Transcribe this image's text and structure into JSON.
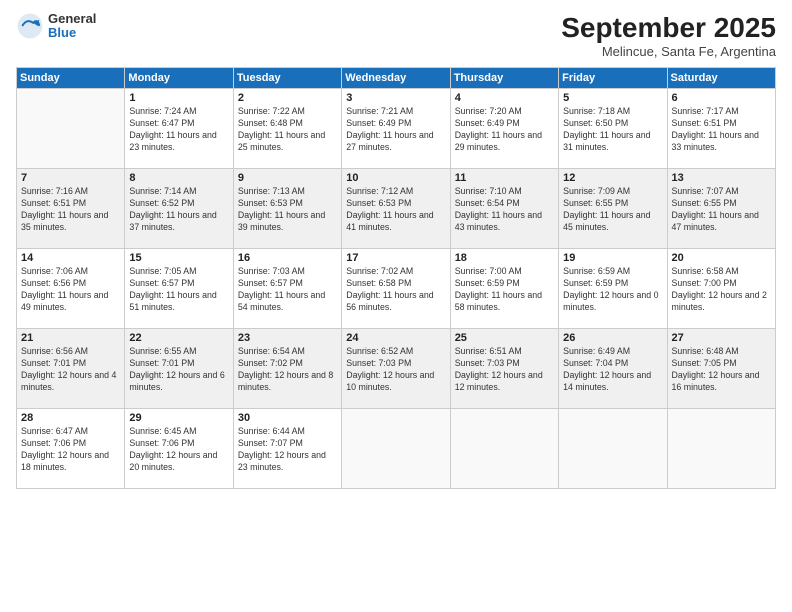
{
  "header": {
    "logo": {
      "general": "General",
      "blue": "Blue"
    },
    "title": "September 2025",
    "subtitle": "Melincue, Santa Fe, Argentina"
  },
  "days": [
    "Sunday",
    "Monday",
    "Tuesday",
    "Wednesday",
    "Thursday",
    "Friday",
    "Saturday"
  ],
  "weeks": [
    [
      {
        "day": "",
        "content": ""
      },
      {
        "day": "1",
        "sunrise": "Sunrise: 7:24 AM",
        "sunset": "Sunset: 6:47 PM",
        "daylight": "Daylight: 11 hours and 23 minutes."
      },
      {
        "day": "2",
        "sunrise": "Sunrise: 7:22 AM",
        "sunset": "Sunset: 6:48 PM",
        "daylight": "Daylight: 11 hours and 25 minutes."
      },
      {
        "day": "3",
        "sunrise": "Sunrise: 7:21 AM",
        "sunset": "Sunset: 6:49 PM",
        "daylight": "Daylight: 11 hours and 27 minutes."
      },
      {
        "day": "4",
        "sunrise": "Sunrise: 7:20 AM",
        "sunset": "Sunset: 6:49 PM",
        "daylight": "Daylight: 11 hours and 29 minutes."
      },
      {
        "day": "5",
        "sunrise": "Sunrise: 7:18 AM",
        "sunset": "Sunset: 6:50 PM",
        "daylight": "Daylight: 11 hours and 31 minutes."
      },
      {
        "day": "6",
        "sunrise": "Sunrise: 7:17 AM",
        "sunset": "Sunset: 6:51 PM",
        "daylight": "Daylight: 11 hours and 33 minutes."
      }
    ],
    [
      {
        "day": "7",
        "sunrise": "Sunrise: 7:16 AM",
        "sunset": "Sunset: 6:51 PM",
        "daylight": "Daylight: 11 hours and 35 minutes."
      },
      {
        "day": "8",
        "sunrise": "Sunrise: 7:14 AM",
        "sunset": "Sunset: 6:52 PM",
        "daylight": "Daylight: 11 hours and 37 minutes."
      },
      {
        "day": "9",
        "sunrise": "Sunrise: 7:13 AM",
        "sunset": "Sunset: 6:53 PM",
        "daylight": "Daylight: 11 hours and 39 minutes."
      },
      {
        "day": "10",
        "sunrise": "Sunrise: 7:12 AM",
        "sunset": "Sunset: 6:53 PM",
        "daylight": "Daylight: 11 hours and 41 minutes."
      },
      {
        "day": "11",
        "sunrise": "Sunrise: 7:10 AM",
        "sunset": "Sunset: 6:54 PM",
        "daylight": "Daylight: 11 hours and 43 minutes."
      },
      {
        "day": "12",
        "sunrise": "Sunrise: 7:09 AM",
        "sunset": "Sunset: 6:55 PM",
        "daylight": "Daylight: 11 hours and 45 minutes."
      },
      {
        "day": "13",
        "sunrise": "Sunrise: 7:07 AM",
        "sunset": "Sunset: 6:55 PM",
        "daylight": "Daylight: 11 hours and 47 minutes."
      }
    ],
    [
      {
        "day": "14",
        "sunrise": "Sunrise: 7:06 AM",
        "sunset": "Sunset: 6:56 PM",
        "daylight": "Daylight: 11 hours and 49 minutes."
      },
      {
        "day": "15",
        "sunrise": "Sunrise: 7:05 AM",
        "sunset": "Sunset: 6:57 PM",
        "daylight": "Daylight: 11 hours and 51 minutes."
      },
      {
        "day": "16",
        "sunrise": "Sunrise: 7:03 AM",
        "sunset": "Sunset: 6:57 PM",
        "daylight": "Daylight: 11 hours and 54 minutes."
      },
      {
        "day": "17",
        "sunrise": "Sunrise: 7:02 AM",
        "sunset": "Sunset: 6:58 PM",
        "daylight": "Daylight: 11 hours and 56 minutes."
      },
      {
        "day": "18",
        "sunrise": "Sunrise: 7:00 AM",
        "sunset": "Sunset: 6:59 PM",
        "daylight": "Daylight: 11 hours and 58 minutes."
      },
      {
        "day": "19",
        "sunrise": "Sunrise: 6:59 AM",
        "sunset": "Sunset: 6:59 PM",
        "daylight": "Daylight: 12 hours and 0 minutes."
      },
      {
        "day": "20",
        "sunrise": "Sunrise: 6:58 AM",
        "sunset": "Sunset: 7:00 PM",
        "daylight": "Daylight: 12 hours and 2 minutes."
      }
    ],
    [
      {
        "day": "21",
        "sunrise": "Sunrise: 6:56 AM",
        "sunset": "Sunset: 7:01 PM",
        "daylight": "Daylight: 12 hours and 4 minutes."
      },
      {
        "day": "22",
        "sunrise": "Sunrise: 6:55 AM",
        "sunset": "Sunset: 7:01 PM",
        "daylight": "Daylight: 12 hours and 6 minutes."
      },
      {
        "day": "23",
        "sunrise": "Sunrise: 6:54 AM",
        "sunset": "Sunset: 7:02 PM",
        "daylight": "Daylight: 12 hours and 8 minutes."
      },
      {
        "day": "24",
        "sunrise": "Sunrise: 6:52 AM",
        "sunset": "Sunset: 7:03 PM",
        "daylight": "Daylight: 12 hours and 10 minutes."
      },
      {
        "day": "25",
        "sunrise": "Sunrise: 6:51 AM",
        "sunset": "Sunset: 7:03 PM",
        "daylight": "Daylight: 12 hours and 12 minutes."
      },
      {
        "day": "26",
        "sunrise": "Sunrise: 6:49 AM",
        "sunset": "Sunset: 7:04 PM",
        "daylight": "Daylight: 12 hours and 14 minutes."
      },
      {
        "day": "27",
        "sunrise": "Sunrise: 6:48 AM",
        "sunset": "Sunset: 7:05 PM",
        "daylight": "Daylight: 12 hours and 16 minutes."
      }
    ],
    [
      {
        "day": "28",
        "sunrise": "Sunrise: 6:47 AM",
        "sunset": "Sunset: 7:06 PM",
        "daylight": "Daylight: 12 hours and 18 minutes."
      },
      {
        "day": "29",
        "sunrise": "Sunrise: 6:45 AM",
        "sunset": "Sunset: 7:06 PM",
        "daylight": "Daylight: 12 hours and 20 minutes."
      },
      {
        "day": "30",
        "sunrise": "Sunrise: 6:44 AM",
        "sunset": "Sunset: 7:07 PM",
        "daylight": "Daylight: 12 hours and 23 minutes."
      },
      {
        "day": "",
        "content": ""
      },
      {
        "day": "",
        "content": ""
      },
      {
        "day": "",
        "content": ""
      },
      {
        "day": "",
        "content": ""
      }
    ]
  ]
}
